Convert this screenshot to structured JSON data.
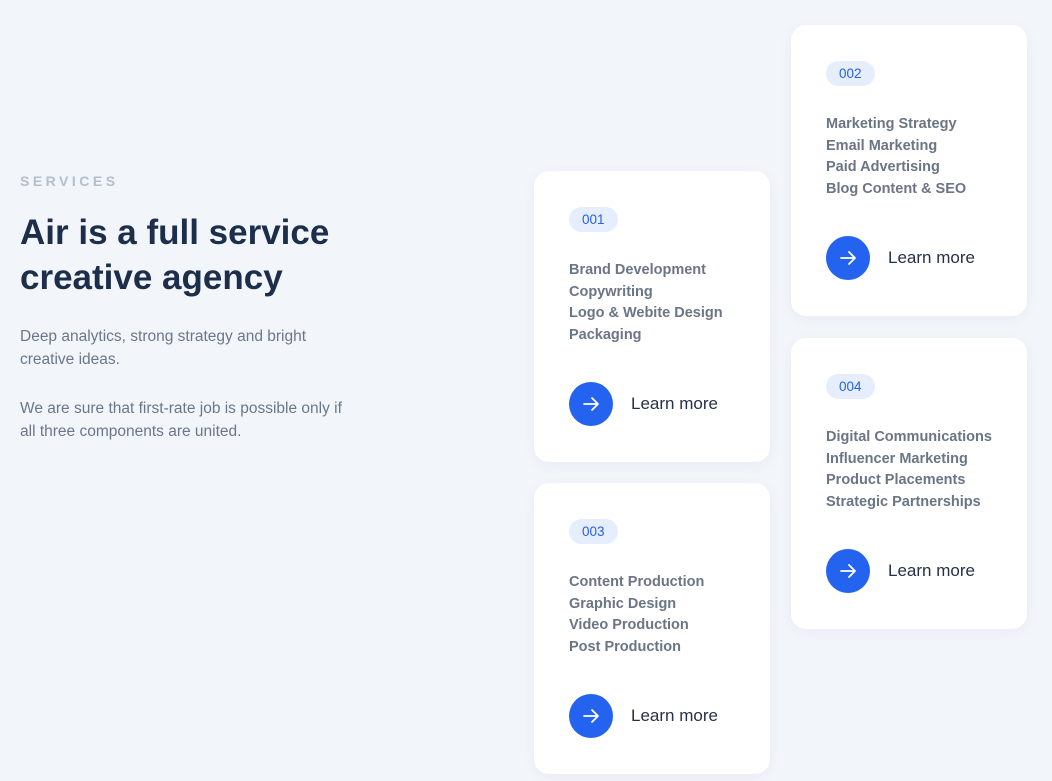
{
  "intro": {
    "eyebrow": "SERVICES",
    "headline_line1": "Air is a full service",
    "headline_line2": "creative agency",
    "paragraph1": "Deep analytics, strong strategy and bright creative ideas.",
    "paragraph2": "We are sure that first-rate job is possible only if all three components are united."
  },
  "colors": {
    "background": "#f2f5fa",
    "accent": "#2363f0",
    "headline": "#1c2e4a",
    "badge_bg": "#e6eefd"
  },
  "cards": [
    {
      "number": "001",
      "items": [
        "Brand Development",
        "Copywriting",
        "Logo & Webite Design",
        "Packaging"
      ],
      "cta_label": "Learn more",
      "cta_icon": "arrow-right-icon"
    },
    {
      "number": "002",
      "items": [
        "Marketing Strategy",
        "Email Marketing",
        "Paid Advertising",
        "Blog Content & SEO"
      ],
      "cta_label": "Learn more",
      "cta_icon": "arrow-right-icon"
    },
    {
      "number": "003",
      "items": [
        "Content Production",
        "Graphic Design",
        "Video Production",
        "Post Production"
      ],
      "cta_label": "Learn more",
      "cta_icon": "arrow-right-icon"
    },
    {
      "number": "004",
      "items": [
        "Digital Communications",
        "Influencer Marketing",
        "Product Placements",
        "Strategic Partnerships"
      ],
      "cta_label": "Learn more",
      "cta_icon": "arrow-right-icon"
    }
  ]
}
